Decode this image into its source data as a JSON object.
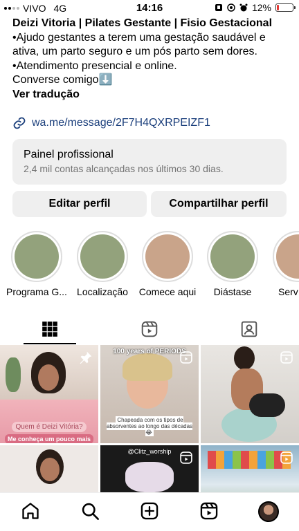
{
  "status_bar": {
    "carrier": "VIVO",
    "network": "4G",
    "time": "14:16",
    "battery": "12%",
    "battery_level": 0.12,
    "battery_color": "#e53935"
  },
  "bio": {
    "name_line": "Deizi Vitoria | Pilates Gestante | Fisio Gestacional",
    "line1": "•Ajudo gestantes a terem uma gestação saudável e ativa, um parto seguro e um pós parto sem dores.",
    "line2": "•Atendimento presencial e online.",
    "line3": "Converse comigo⬇️",
    "translate_link": "Ver tradução"
  },
  "link": {
    "icon": "link-icon",
    "text": "wa.me/message/2F7H4QXRPEIZF1",
    "color": "#1a3e7b"
  },
  "professional_panel": {
    "title": "Painel profissional",
    "subtitle": "2,4 mil contas alcançadas nos últimos 30 dias."
  },
  "buttons": {
    "edit": "Editar perfil",
    "share": "Compartilhar perfil"
  },
  "highlights": [
    {
      "label": "Programa G...",
      "color": "#93a27c"
    },
    {
      "label": "Localização",
      "color": "#93a27c"
    },
    {
      "label": "Comece aqui",
      "color": "#c9a48a"
    },
    {
      "label": "Diástase",
      "color": "#93a27c"
    },
    {
      "label": "Serv",
      "color": "#c9a48a"
    }
  ],
  "tabs": [
    {
      "icon": "grid-icon"
    },
    {
      "icon": "reels-icon"
    },
    {
      "icon": "tagged-icon"
    }
  ],
  "posts": {
    "p1_caption1": "Quem é Deizi Vitória?",
    "p1_caption2": "Me conheça um pouco mais",
    "p2_caption_top": "100 years of PERIODS",
    "p2_caption_bottom": "Chapeada com os tipos de absorventes ao longo das décadas 😂",
    "p5_caption": "@Clitz_worship"
  },
  "nav": [
    {
      "icon": "home-icon"
    },
    {
      "icon": "search-icon"
    },
    {
      "icon": "create-icon"
    },
    {
      "icon": "reels-icon"
    },
    {
      "icon": "profile-avatar"
    }
  ]
}
